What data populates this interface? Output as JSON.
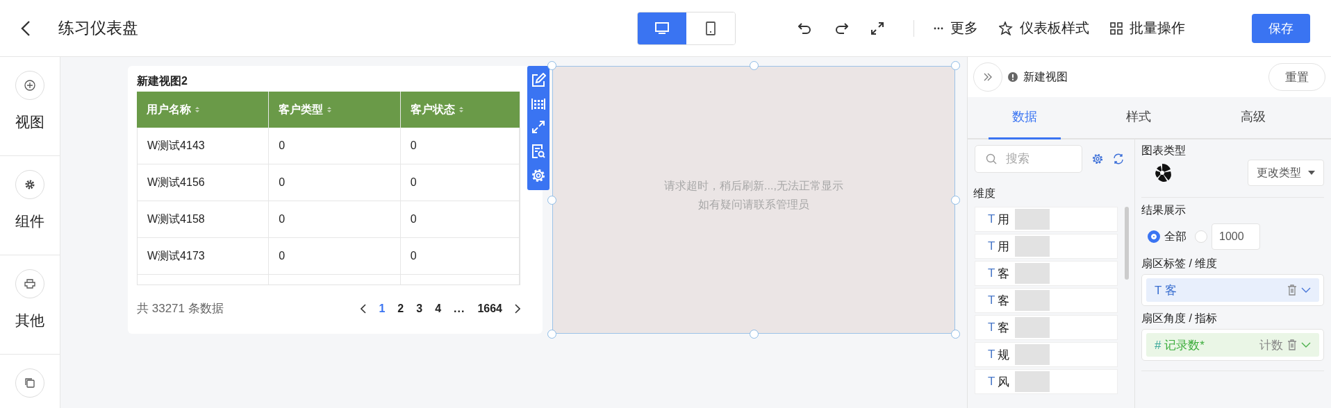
{
  "header": {
    "title": "练习仪表盘",
    "device_toggle": [
      {
        "kind": "desktop",
        "selected": true
      },
      {
        "kind": "mobile",
        "selected": false
      }
    ],
    "menu": [
      {
        "kind": "more",
        "label": "更多"
      },
      {
        "kind": "style",
        "label": "仪表板样式"
      },
      {
        "kind": "batch",
        "label": "批量操作"
      }
    ],
    "save": "保存"
  },
  "sidebar": [
    {
      "kind": "add",
      "label": "视图"
    },
    {
      "kind": "gear",
      "label": "组件"
    },
    {
      "kind": "other",
      "label": "其他"
    },
    {
      "kind": "copy"
    }
  ],
  "table_widget": {
    "title": "新建视图2",
    "columns": [
      "用户名称",
      "客户类型",
      "客户状态"
    ],
    "rows": [
      [
        "W测试4143",
        "0",
        "0"
      ],
      [
        "W测试4156",
        "0",
        "0"
      ],
      [
        "W测试4158",
        "0",
        "0"
      ],
      [
        "W测试4173",
        "0",
        "0"
      ]
    ],
    "total": "共 33271 条数据",
    "pages": [
      {
        "kind": "page",
        "label": "1",
        "selected": true
      },
      {
        "kind": "page",
        "label": "2",
        "selected": false
      },
      {
        "kind": "page",
        "label": "3",
        "selected": false
      },
      {
        "kind": "page",
        "label": "4",
        "selected": false
      },
      {
        "kind": "ellipsis",
        "label": "...",
        "selected": false
      },
      {
        "kind": "page",
        "label": "1664",
        "selected": false
      }
    ]
  },
  "chart_widget": {
    "message_lines": [
      "请求超时，稍后刷新...,无法正常显示",
      "如有疑问请联系管理员"
    ]
  },
  "panel": {
    "title": "新建视图",
    "reset": "重置",
    "tabs": [
      {
        "label": "数据",
        "selected": true
      },
      {
        "label": "样式",
        "selected": false
      },
      {
        "label": "高级",
        "selected": false
      }
    ],
    "search": {
      "placeholder": "搜索"
    },
    "dimension_label": "维度",
    "fields": [
      {
        "type": "T",
        "label": "用"
      },
      {
        "type": "T",
        "label": "用"
      },
      {
        "type": "T",
        "label": "客"
      },
      {
        "type": "T",
        "label": "客"
      },
      {
        "type": "T",
        "label": "客"
      },
      {
        "type": "T",
        "label": "规"
      },
      {
        "type": "T",
        "label": "风"
      }
    ],
    "chart_type_label": "图表类型",
    "change_type": "更改类型",
    "result_label": "结果展示",
    "result_options": [
      {
        "label": "全部",
        "selected": true
      },
      {
        "value": "1000",
        "selected": false
      }
    ],
    "sector_label": "扇区标签 / 维度",
    "sector_field": {
      "type": "T",
      "label": "客"
    },
    "angle_label": "扇区角度 / 指标",
    "angle_field": {
      "type": "#",
      "label": "记录数*",
      "aggregation": "计数"
    }
  }
}
